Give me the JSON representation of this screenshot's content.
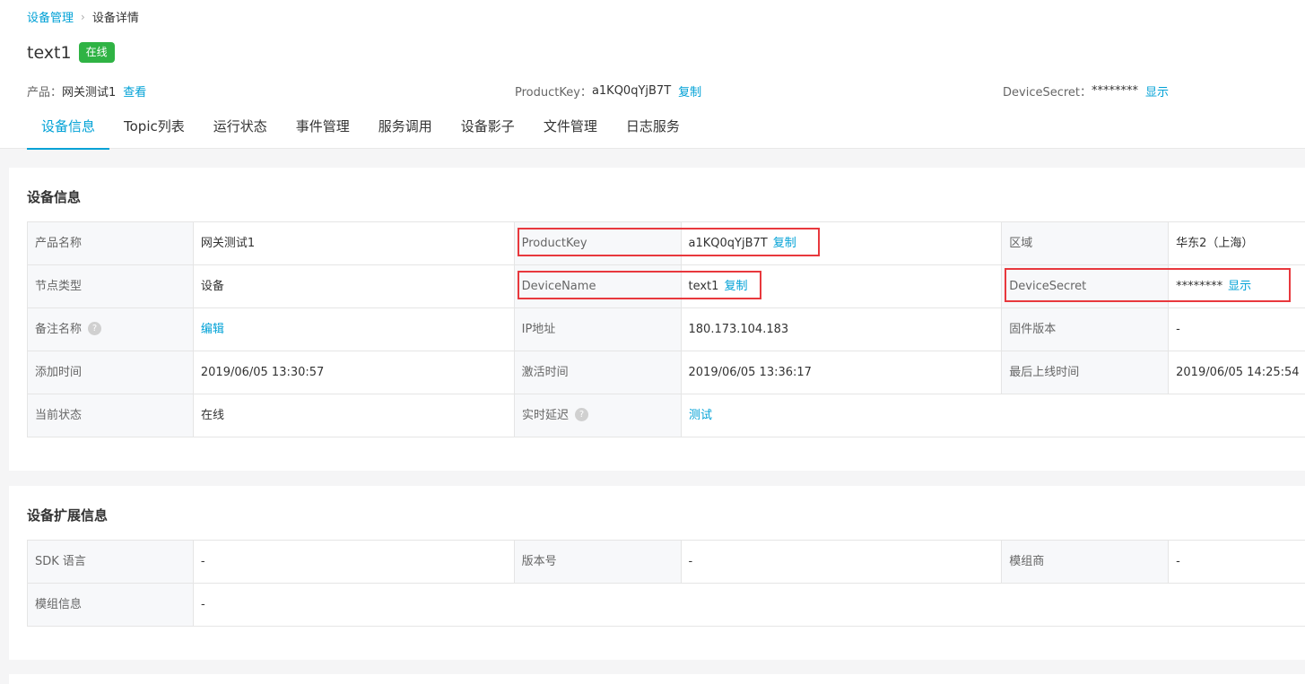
{
  "breadcrumb": {
    "parent": "设备管理",
    "current": "设备详情",
    "separator": "›"
  },
  "device": {
    "name": "text1",
    "status_badge": "在线"
  },
  "meta": {
    "product_label": "产品：",
    "product_value": "网关测试1",
    "product_link": "查看",
    "productkey_label": "ProductKey：",
    "productkey_value": "a1KQ0qYjB7T",
    "productkey_link": "复制",
    "devicesecret_label": "DeviceSecret：",
    "devicesecret_value": "********",
    "devicesecret_link": "显示"
  },
  "tabs": [
    {
      "label": "设备信息",
      "active": true
    },
    {
      "label": "Topic列表"
    },
    {
      "label": "运行状态"
    },
    {
      "label": "事件管理"
    },
    {
      "label": "服务调用"
    },
    {
      "label": "设备影子"
    },
    {
      "label": "文件管理"
    },
    {
      "label": "日志服务"
    }
  ],
  "device_info": {
    "title": "设备信息",
    "product_name_label": "产品名称",
    "product_name_value": "网关测试1",
    "productkey_label": "ProductKey",
    "productkey_value": "a1KQ0qYjB7T",
    "productkey_copy": "复制",
    "region_label": "区域",
    "region_value": "华东2（上海）",
    "node_type_label": "节点类型",
    "node_type_value": "设备",
    "devicename_label": "DeviceName",
    "devicename_value": "text1",
    "devicename_copy": "复制",
    "devicesecret_label": "DeviceSecret",
    "devicesecret_value": "********",
    "devicesecret_show": "显示",
    "remark_label": "备注名称",
    "remark_edit": "编辑",
    "ip_label": "IP地址",
    "ip_value": "180.173.104.183",
    "firmware_label": "固件版本",
    "firmware_value": "-",
    "added_label": "添加时间",
    "added_value": "2019/06/05 13:30:57",
    "activated_label": "激活时间",
    "activated_value": "2019/06/05 13:36:17",
    "last_online_label": "最后上线时间",
    "last_online_value": "2019/06/05 14:25:54",
    "state_label": "当前状态",
    "state_value": "在线",
    "latency_label": "实时延迟",
    "latency_test": "测试",
    "help_glyph": "?"
  },
  "ext_info": {
    "title": "设备扩展信息",
    "sdk_label": "SDK 语言",
    "sdk_value": "-",
    "version_label": "版本号",
    "version_value": "-",
    "vendor_label": "模组商",
    "vendor_value": "-",
    "module_label": "模组信息",
    "module_value": "-"
  },
  "colors": {
    "accent": "#00a1d6",
    "online_badge": "#2fb344",
    "highlight_box": "#e8383d",
    "label_bg": "#f7f8fa",
    "page_bg": "#f5f5f6"
  }
}
